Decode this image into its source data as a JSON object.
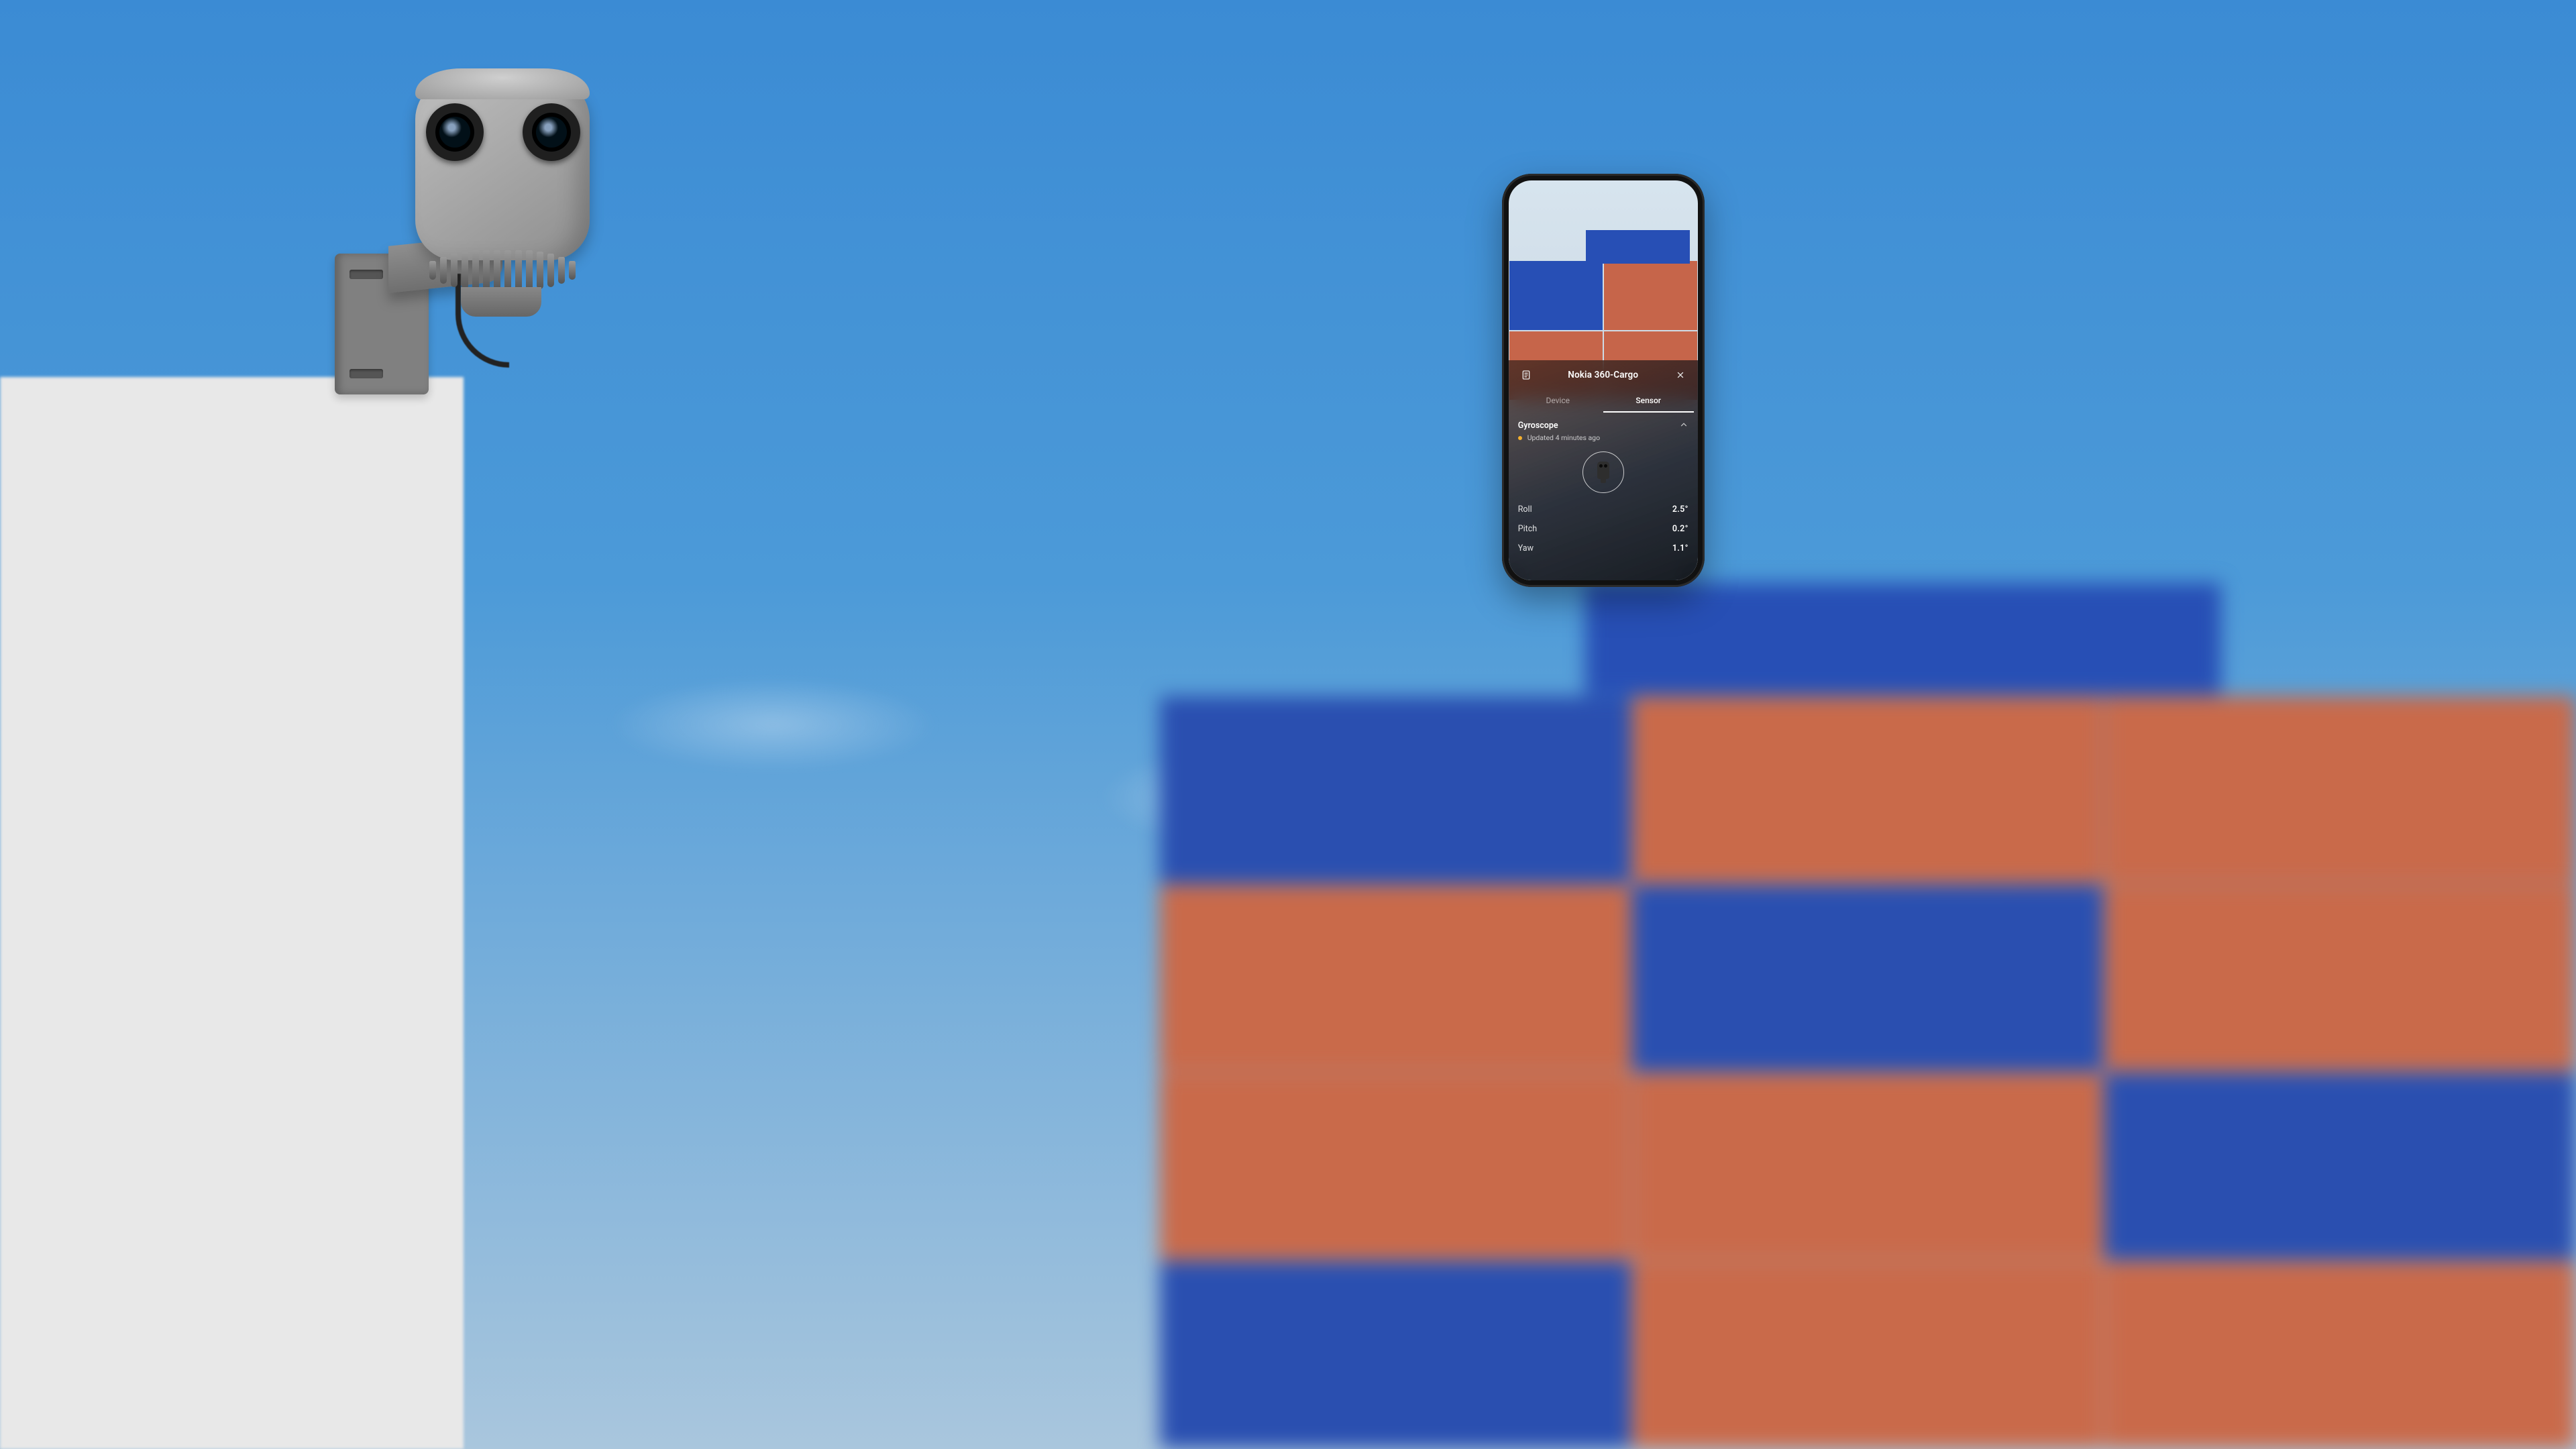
{
  "device_name": "Nokia 360-Cargo",
  "tabs": {
    "device": "Device",
    "sensor": "Sensor",
    "active": "sensor"
  },
  "sensor": {
    "section_title": "Gyroscope",
    "updated_text": "Updated 4 minutes ago",
    "metrics": {
      "roll": {
        "label": "Roll",
        "value": "2.5°"
      },
      "pitch": {
        "label": "Pitch",
        "value": "0.2°"
      },
      "yaw": {
        "label": "Yaw",
        "value": "1.1°"
      }
    }
  },
  "icons": {
    "notes": "notes-icon",
    "close": "close-icon",
    "chevron_up": "chevron-up-icon"
  },
  "colors": {
    "status_dot": "#f5b02e",
    "card_tint": "#1a1e28"
  }
}
